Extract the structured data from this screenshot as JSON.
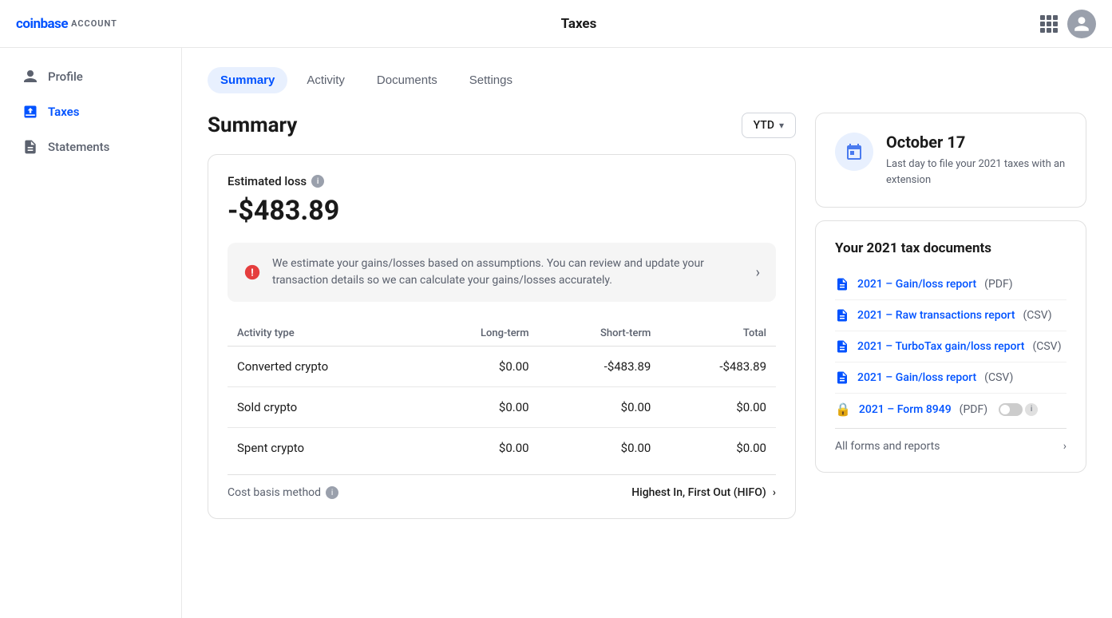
{
  "brand": {
    "logo": "coinbase",
    "account_label": "ACCOUNT"
  },
  "header": {
    "title": "Taxes"
  },
  "sidebar": {
    "items": [
      {
        "id": "profile",
        "label": "Profile",
        "icon": "person-icon",
        "active": false
      },
      {
        "id": "taxes",
        "label": "Taxes",
        "icon": "taxes-icon",
        "active": true
      },
      {
        "id": "statements",
        "label": "Statements",
        "icon": "statements-icon",
        "active": false
      }
    ]
  },
  "tabs": [
    {
      "id": "summary",
      "label": "Summary",
      "active": true
    },
    {
      "id": "activity",
      "label": "Activity",
      "active": false
    },
    {
      "id": "documents",
      "label": "Documents",
      "active": false
    },
    {
      "id": "settings",
      "label": "Settings",
      "active": false
    }
  ],
  "summary": {
    "title": "Summary",
    "ytd_label": "YTD",
    "estimated_loss_label": "Estimated loss",
    "estimated_loss_value": "-$483.89",
    "alert_text": "We estimate your gains/losses based on assumptions. You can review and update your transaction details so we can calculate your gains/losses accurately.",
    "table": {
      "columns": [
        "Activity type",
        "Long-term",
        "Short-term",
        "Total"
      ],
      "rows": [
        {
          "type": "Converted crypto",
          "long_term": "$0.00",
          "short_term": "-$483.89",
          "total": "-$483.89"
        },
        {
          "type": "Sold crypto",
          "long_term": "$0.00",
          "short_term": "$0.00",
          "total": "$0.00"
        },
        {
          "type": "Spent crypto",
          "long_term": "$0.00",
          "short_term": "$0.00",
          "total": "$0.00"
        }
      ]
    },
    "cost_basis_label": "Cost basis method",
    "cost_basis_value": "Highest In, First Out (HIFO)"
  },
  "right_panel": {
    "deadline": {
      "date": "October 17",
      "description": "Last day to file your 2021 taxes with an extension"
    },
    "tax_docs": {
      "title": "Your 2021 tax documents",
      "docs": [
        {
          "id": "gain-loss-pdf",
          "link": "2021 – Gain/loss report",
          "type": "(PDF)",
          "icon": "document-icon",
          "locked": false
        },
        {
          "id": "raw-transactions-csv",
          "link": "2021 – Raw transactions report",
          "type": "(CSV)",
          "icon": "document-icon",
          "locked": false
        },
        {
          "id": "turbotax-csv",
          "link": "2021 – TurboTax gain/loss report",
          "type": "(CSV)",
          "icon": "document-icon",
          "locked": false
        },
        {
          "id": "gain-loss-csv",
          "link": "2021 – Gain/loss report",
          "type": "(CSV)",
          "icon": "document-icon",
          "locked": false
        },
        {
          "id": "form-8949",
          "link": "2021 – Form 8949",
          "type": "(PDF)",
          "icon": "lock-icon",
          "locked": true
        }
      ],
      "all_forms_label": "All forms and reports"
    }
  }
}
